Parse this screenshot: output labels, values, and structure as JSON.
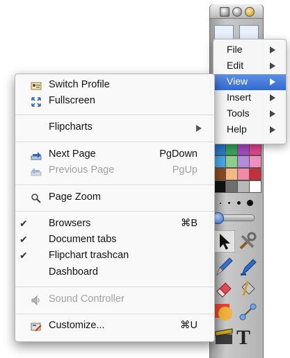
{
  "menu_bar": {
    "items": [
      {
        "label": "File",
        "selected": false
      },
      {
        "label": "Edit",
        "selected": false
      },
      {
        "label": "View",
        "selected": true
      },
      {
        "label": "Insert",
        "selected": false
      },
      {
        "label": "Tools",
        "selected": false
      },
      {
        "label": "Help",
        "selected": false
      }
    ]
  },
  "view_menu": {
    "switch_profile": {
      "label": "Switch Profile",
      "icon": "profile-icon"
    },
    "fullscreen": {
      "label": "Fullscreen",
      "icon": "fullscreen-icon"
    },
    "flipcharts": {
      "label": "Flipcharts",
      "icon": "chevron-right-icon"
    },
    "next_page": {
      "label": "Next Page",
      "shortcut": "PgDown",
      "icon": "next-page-icon"
    },
    "previous_page": {
      "label": "Previous Page",
      "shortcut": "PgUp",
      "icon": "previous-page-icon",
      "disabled": true
    },
    "page_zoom": {
      "label": "Page Zoom",
      "icon": "magnifier-icon"
    },
    "browsers": {
      "label": "Browsers",
      "shortcut": "⌘B",
      "checked": true
    },
    "document_tabs": {
      "label": "Document tabs",
      "checked": true
    },
    "flipchart_trashcan": {
      "label": "Flipchart trashcan",
      "checked": true
    },
    "dashboard": {
      "label": "Dashboard",
      "checked": false
    },
    "sound_controller": {
      "label": "Sound Controller",
      "icon": "speaker-icon",
      "disabled": true
    },
    "customize": {
      "label": "Customize...",
      "shortcut": "⌘U",
      "icon": "customize-icon"
    },
    "check_mark": "✔"
  },
  "colors": {
    "selection": "#3469d1",
    "disabled_text": "#a0a0a0"
  },
  "toolbox": {
    "tools": [
      "pointer-tool-icon",
      "tools-icon",
      "pen-tool-icon",
      "highlighter-tool-icon",
      "eraser-tool-icon",
      "fill-tool-icon",
      "shape-tool-icon",
      "connector-tool-icon",
      "clapper-tool-icon",
      "text-tool-icon"
    ],
    "text_tool_glyph": "T"
  }
}
